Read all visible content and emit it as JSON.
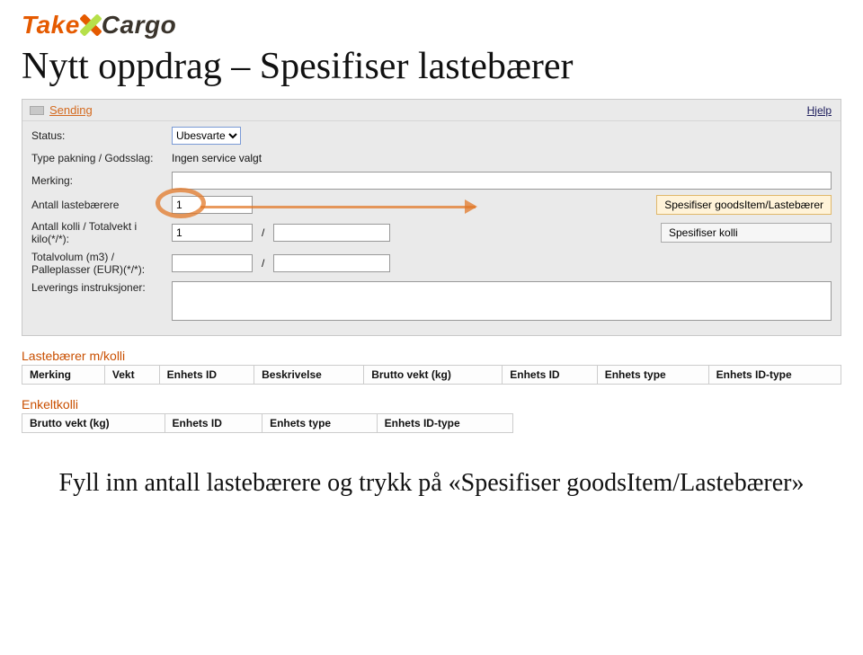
{
  "logo": {
    "take": "Take",
    "cargo": "Cargo"
  },
  "title": "Nytt oppdrag – Spesifiser lastebærer",
  "panel": {
    "tab": "Sending",
    "help": "Hjelp"
  },
  "form": {
    "status_label": "Status:",
    "status_value": "Ubesvarte",
    "type_pakning_label": "Type pakning / Godsslag:",
    "type_pakning_value": "Ingen service valgt",
    "merking_label": "Merking:",
    "merking_value": "",
    "antall_lastebaerere_label": "Antall lastebærere",
    "antall_lastebaerere_value": "1",
    "spesifiser_goods_btn": "Spesifiser goodsItem/Lastebærer",
    "antall_kolli_label": "Antall kolli / Totalvekt i kilo(*/*):",
    "antall_kolli_value": "1",
    "totalvekt_value": "",
    "spesifiser_kolli_btn": "Spesifiser kolli",
    "totalvolum_label": "Totalvolum (m3) / Palleplasser (EUR)(*/*):",
    "totalvolum_value": "",
    "palleplasser_value": "",
    "leverings_label": "Leverings instruksjoner:",
    "leverings_value": ""
  },
  "section1": {
    "title": "Lastebærer m/kolli",
    "headers": [
      "Merking",
      "Vekt",
      "Enhets ID",
      "Beskrivelse",
      "Brutto vekt (kg)",
      "Enhets ID",
      "Enhets type",
      "Enhets ID-type"
    ]
  },
  "section2": {
    "title": "Enkeltkolli",
    "headers": [
      "Brutto vekt (kg)",
      "Enhets ID",
      "Enhets type",
      "Enhets ID-type"
    ]
  },
  "instruction": "Fyll inn antall lastebærere og trykk på «Spesifiser goodsItem/Lastebærer»"
}
